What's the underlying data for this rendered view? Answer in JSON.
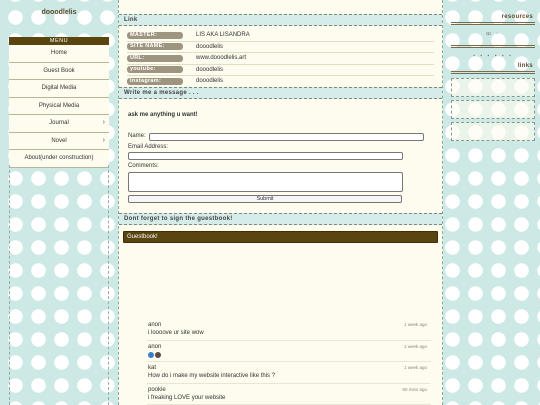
{
  "site_title": "dooodlelis",
  "menu": {
    "header": "MENU",
    "items": [
      {
        "label": "Home",
        "has_submenu": false
      },
      {
        "label": "Guest Book",
        "has_submenu": false
      },
      {
        "label": "Digital Media",
        "has_submenu": false
      },
      {
        "label": "Physical Media",
        "has_submenu": false
      },
      {
        "label": "Journal",
        "has_submenu": true
      },
      {
        "label": "Novel",
        "has_submenu": true
      },
      {
        "label": "About(under construction)",
        "has_submenu": false
      }
    ]
  },
  "link_section": {
    "header": "Link",
    "rows": [
      {
        "key": "MASTER:",
        "value": "LIS AKA LISANDRA"
      },
      {
        "key": "SITE NAME:",
        "value": "dooodlelis"
      },
      {
        "key": "URL:",
        "value": "www.dooodlelis.art"
      },
      {
        "key": "youtube:",
        "value": "dooodlelis"
      },
      {
        "key": "Instagram:",
        "value": "dooodlelis"
      }
    ]
  },
  "message_section": {
    "header": "Write me a message . . .",
    "title": "ask me anything u want!",
    "name_label": "Name:",
    "email_label": "Email Address:",
    "comments_label": "Comments:",
    "submit_label": "Submit"
  },
  "guestbook_section": {
    "header": "Dont forget to sign the guestbook!",
    "bar_label": "Guestbook!",
    "entries": [
      {
        "name": "anon",
        "message": "i loooove ur site wow",
        "time": "1 week ago",
        "emoji": false
      },
      {
        "name": "anon",
        "message": "",
        "time": "1 week ago",
        "emoji": true
      },
      {
        "name": "kat",
        "message": "How do i make my website interactive like this ?",
        "time": "1 week ago",
        "emoji": false
      },
      {
        "name": "pookie",
        "message": "i freaking LOVE your website",
        "time": "60 mins ago",
        "emoji": false
      }
    ]
  },
  "right_sidebar": {
    "resources_title": "resources",
    "links_title": "links"
  },
  "colors": {
    "background": "#cde9e6",
    "accent_brown": "#5a4510",
    "panel": "#fdfcee",
    "key_badge": "#9e9580"
  }
}
